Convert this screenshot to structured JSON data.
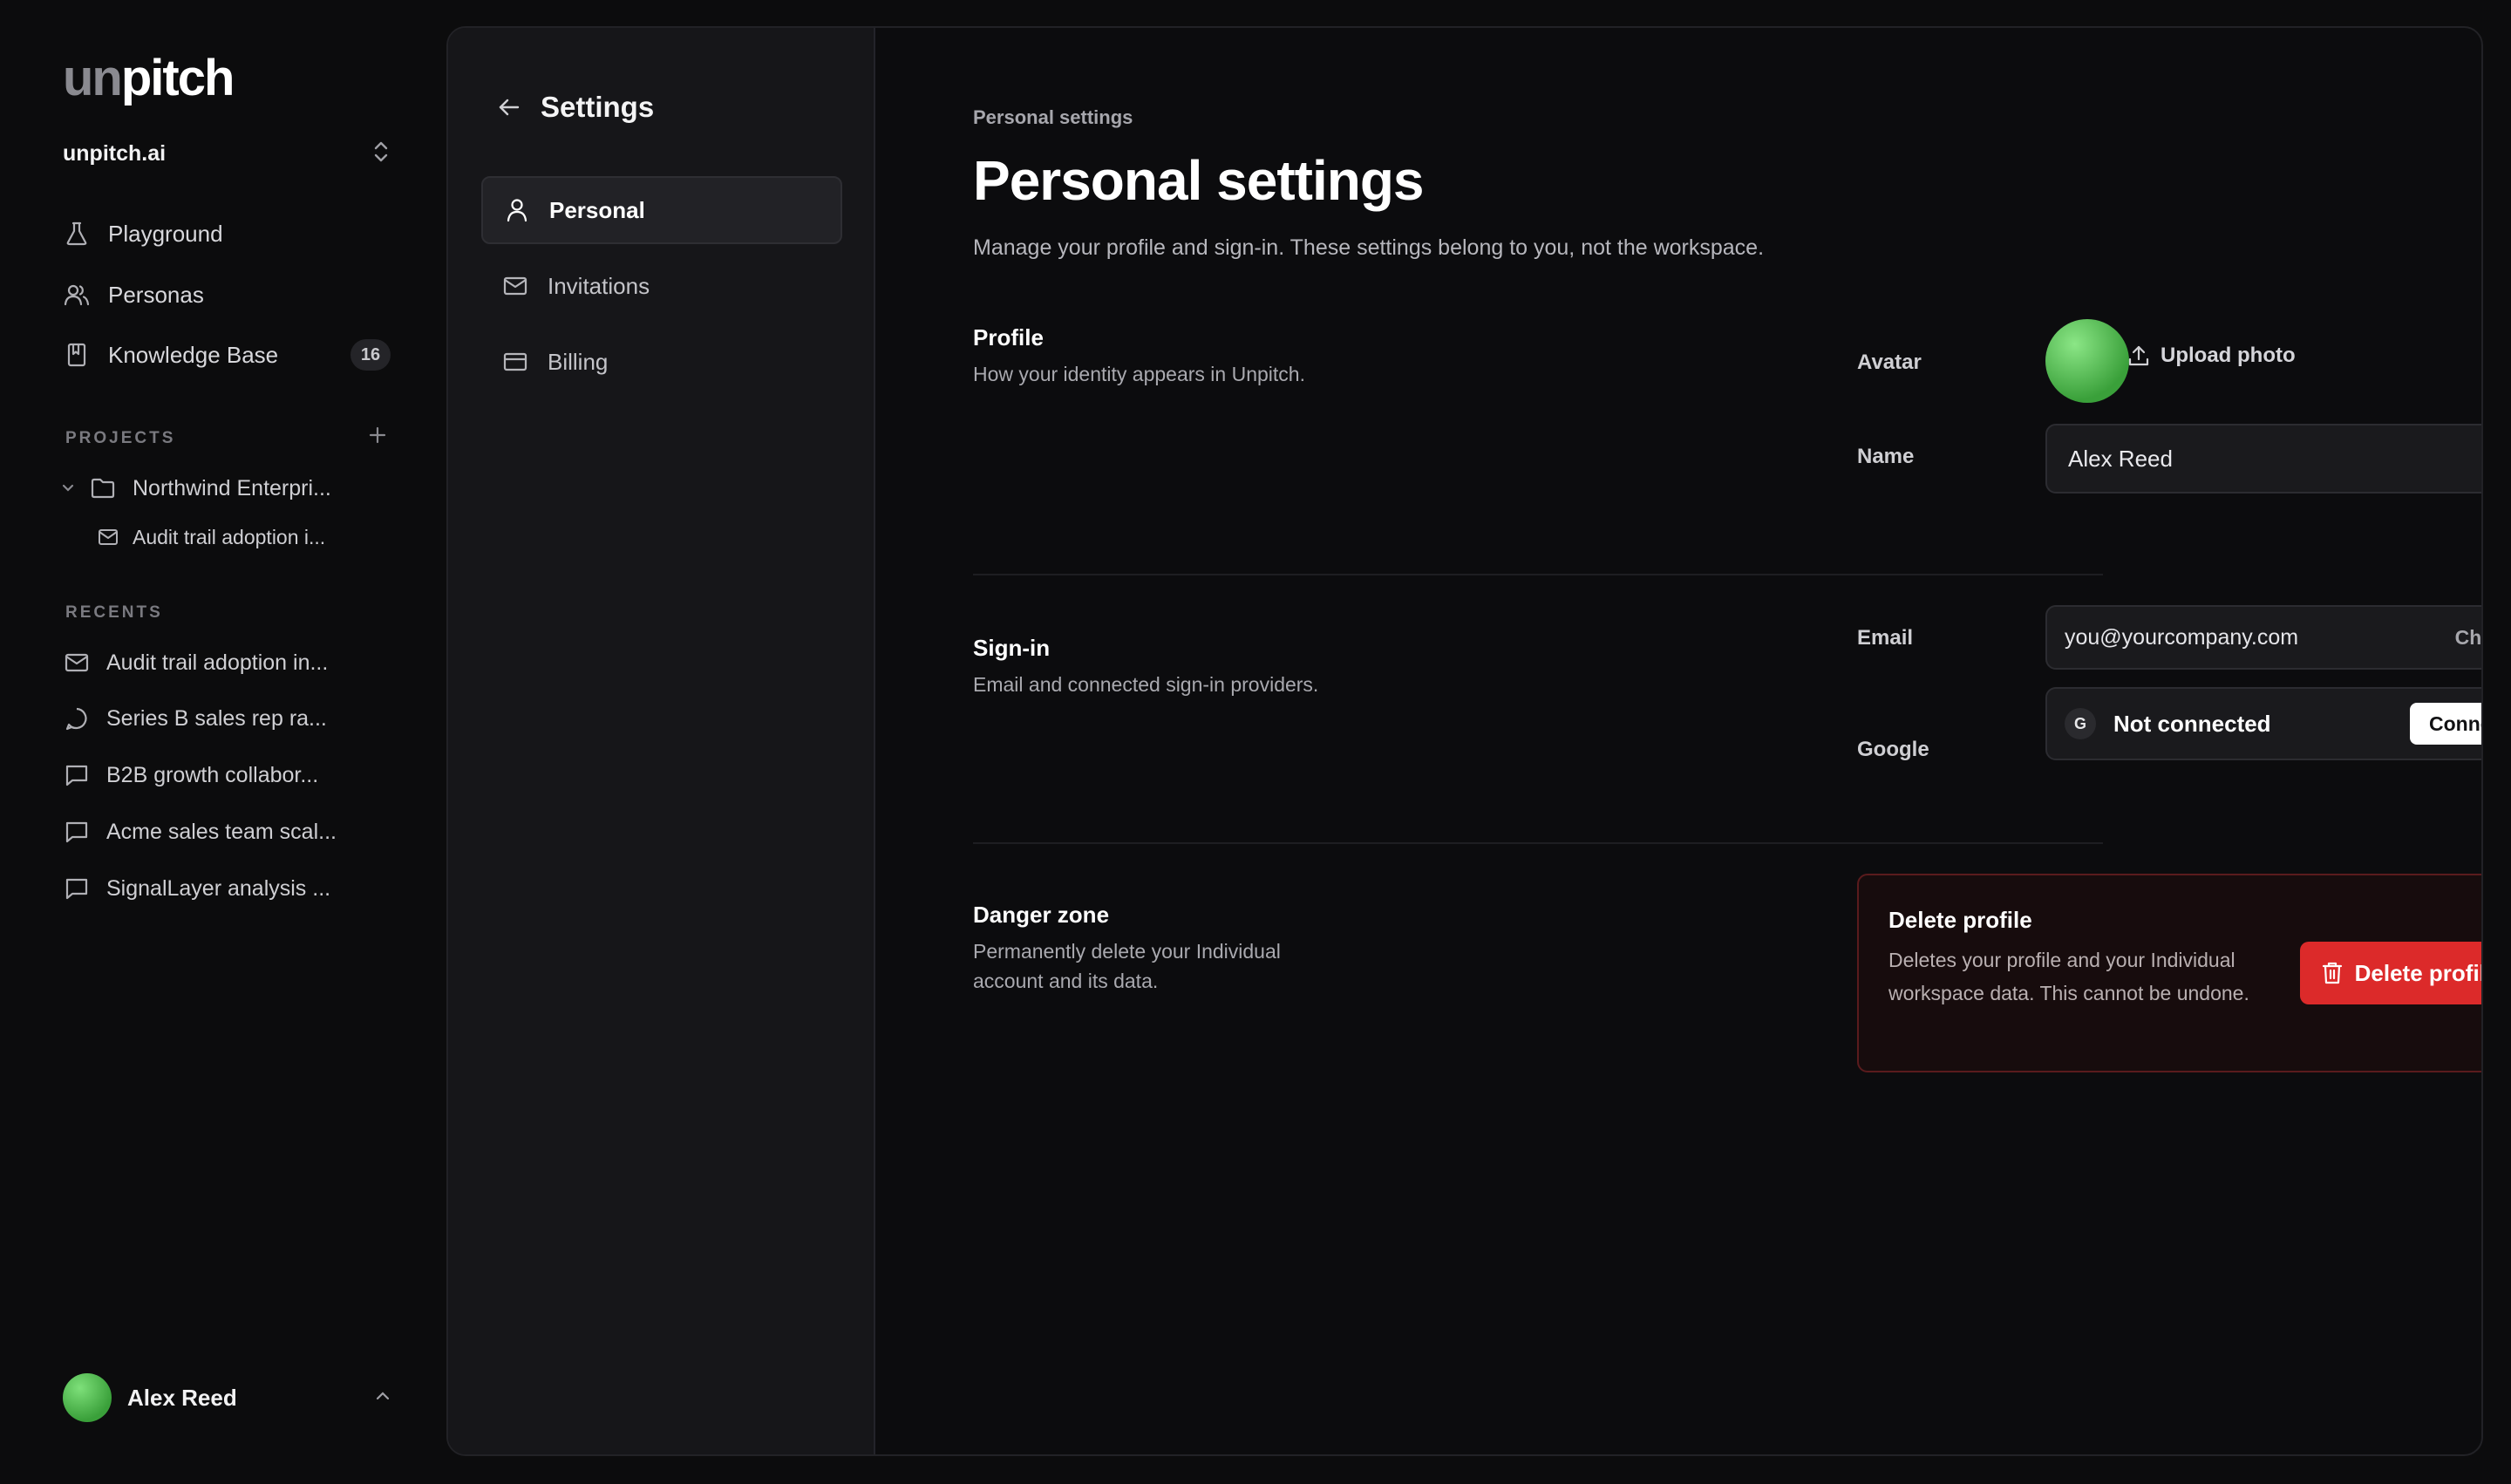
{
  "app": {
    "logo_prefix": "un",
    "logo_suffix": "pitch",
    "workspace": "unpitch.ai"
  },
  "sidebar": {
    "nav": [
      {
        "label": "Playground",
        "icon": "flask-icon"
      },
      {
        "label": "Personas",
        "icon": "users-icon"
      },
      {
        "label": "Knowledge Base",
        "icon": "book-icon",
        "badge": "16"
      }
    ],
    "projects_title": "PROJECTS",
    "projects": [
      {
        "label": "Northwind Enterpri...",
        "icon": "folder-icon"
      },
      {
        "label": "Audit trail adoption i...",
        "icon": "mail-icon"
      }
    ],
    "recents_title": "RECENTS",
    "recents": [
      {
        "label": "Audit trail adoption in...",
        "icon": "mail-icon"
      },
      {
        "label": "Series B sales rep ra...",
        "icon": "chat-bubble-icon"
      },
      {
        "label": "B2B growth collabor...",
        "icon": "message-square-icon"
      },
      {
        "label": "Acme sales team scal...",
        "icon": "message-square-icon"
      },
      {
        "label": "SignalLayer analysis ...",
        "icon": "message-square-icon"
      }
    ],
    "user": {
      "name": "Alex Reed"
    }
  },
  "settings_nav": {
    "title": "Settings",
    "items": [
      {
        "label": "Personal",
        "icon": "user-icon",
        "active": true
      },
      {
        "label": "Invitations",
        "icon": "mail-icon",
        "active": false
      },
      {
        "label": "Billing",
        "icon": "credit-card-icon",
        "active": false
      }
    ]
  },
  "page": {
    "breadcrumb": "Personal settings",
    "title": "Personal settings",
    "description": "Manage your profile and sign-in. These settings belong to you, not the workspace."
  },
  "profile": {
    "title": "Profile",
    "description": "How your identity appears in Unpitch.",
    "avatar_label": "Avatar",
    "upload_label": "Upload photo",
    "name_label": "Name",
    "name_value": "Alex Reed"
  },
  "signin": {
    "title": "Sign-in",
    "description": "Email and connected sign-in providers.",
    "email_label": "Email",
    "email_value": "you@yourcompany.com",
    "change_label": "Change",
    "google_label": "Google",
    "google_glyph": "G",
    "google_status": "Not connected",
    "connect_label": "Connect"
  },
  "danger": {
    "title": "Danger zone",
    "description": "Permanently delete your Individual account and its data.",
    "box_title": "Delete profile",
    "box_description": "Deletes your profile and your Individual workspace data. This cannot be undone.",
    "button_label": "Delete profile"
  },
  "colors": {
    "accent_danger": "#dc2a2a",
    "avatar_green": "#4cc24a",
    "background": "#0c0c0d"
  }
}
